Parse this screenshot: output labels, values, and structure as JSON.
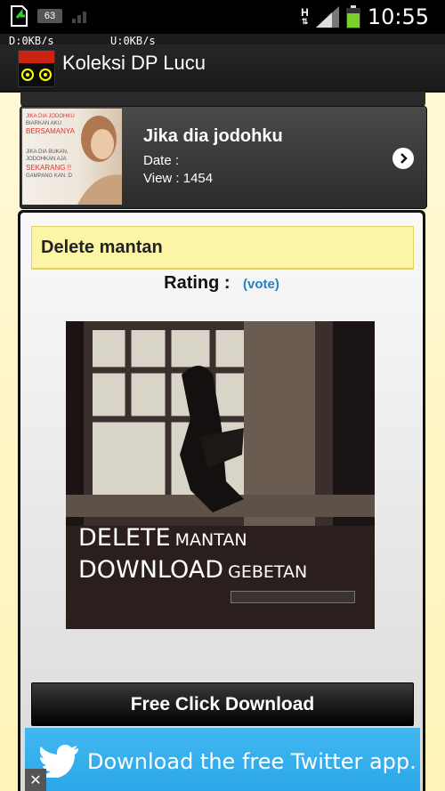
{
  "status_bar": {
    "battery_text": "63",
    "network_type": "H",
    "time": "10:55"
  },
  "net_speed": {
    "down": "D:0KB/s",
    "up": "U:0KB/s"
  },
  "app": {
    "logo_text": "Koleksi DP Lucu",
    "title": "Koleksi DP Lucu"
  },
  "list_item": {
    "thumb_lines": [
      "JIKA DIA JODOHKU",
      "BIARKAN AKU",
      "BERSAMANYA",
      "JIKA DIA BUKAN,",
      "JODOHKAN AJA",
      "SEKARANG !!",
      "GAMPANG KAN :D"
    ],
    "title": "Jika dia jodohku",
    "date": "Date :",
    "view": "View : 1454"
  },
  "detail": {
    "title": "Delete mantan",
    "rating_label": "Rating :",
    "vote_link": "(vote)",
    "image_line1_big": "DELETE",
    "image_line1_small": "MANTAN",
    "image_line2_big": "DOWNLOAD",
    "image_line2_small": "GEBETAN",
    "download_button": "Free Click Download"
  },
  "ad": {
    "text": "Download the free Twitter app.",
    "close": "✕"
  },
  "colors": {
    "accent": "#1f82c0",
    "title_bar": "#fdf5a6",
    "ad_blue": "#2aa6e8"
  }
}
